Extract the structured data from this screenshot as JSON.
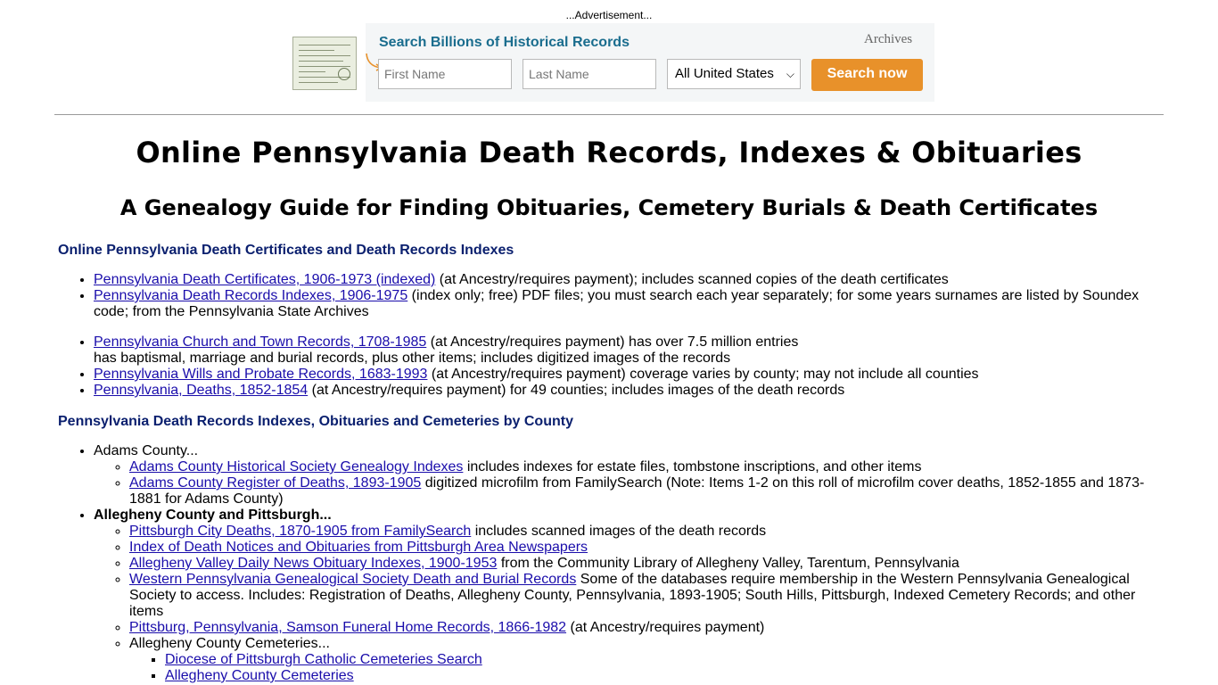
{
  "ad": {
    "label": "...Advertisement...",
    "title": "Search Billions of Historical Records",
    "brand": "Archives",
    "first_name_placeholder": "First Name",
    "last_name_placeholder": "Last Name",
    "location_selected": "All United States",
    "search_button": "Search now",
    "accent_color": "#e8912a",
    "title_color": "#1a6d8e"
  },
  "page": {
    "title": "Online Pennsylvania Death Records, Indexes & Obituaries",
    "subtitle": "A Genealogy Guide for Finding Obituaries, Cemetery Burials & Death Certificates",
    "link_color": "#1a0dab",
    "heading_color": "#0a1f6e"
  },
  "section1": {
    "heading": "Online Pennsylvania Death Certificates and Death Records Indexes",
    "items": [
      {
        "link": "Pennsylvania Death Certificates, 1906-1973 (indexed)",
        "text": " (at Ancestry/requires payment); includes scanned copies of the death certificates"
      },
      {
        "link": "Pennsylvania Death Records Indexes, 1906-1975",
        "text": " (index only; free) PDF files; you must search each year separately; for some years surnames are listed by Soundex code; from the Pennsylvania State Archives"
      },
      {
        "link": "Pennsylvania Church and Town Records, 1708-1985",
        "text": " (at Ancestry/requires payment) has over 7.5 million entries",
        "text2": "has baptismal, marriage and burial records, plus other items; includes digitized images of the records"
      },
      {
        "link": "Pennsylvania Wills and Probate Records, 1683-1993",
        "text": " (at Ancestry/requires payment) coverage varies by county; may not include all counties"
      },
      {
        "link": "Pennsylvania, Deaths, 1852-1854",
        "text": " (at Ancestry/requires payment) for 49 counties; includes images of the death records"
      }
    ]
  },
  "section2": {
    "heading": "Pennsylvania Death Records Indexes, Obituaries and Cemeteries by County",
    "adams": {
      "label": "Adams County...",
      "items": [
        {
          "link": "Adams County Historical Society Genealogy Indexes",
          "text": " includes indexes for estate files, tombstone inscriptions, and other items"
        },
        {
          "link": "Adams County Register of Deaths, 1893-1905",
          "text": " digitized microfilm from FamilySearch (Note: Items 1-2 on this roll of microfilm cover deaths, 1852-1855 and 1873-1881 for Adams County)"
        }
      ]
    },
    "allegheny": {
      "label": "Allegheny County and Pittsburgh...",
      "items": [
        {
          "link": "Pittsburgh City Deaths, 1870-1905 from FamilySearch",
          "text": " includes scanned images of the death records"
        },
        {
          "link": "Index of Death Notices and Obituaries from Pittsburgh Area Newspapers",
          "text": ""
        },
        {
          "link": "Allegheny Valley Daily News Obituary Indexes, 1900-1953",
          "text": " from the Community Library of Allegheny Valley, Tarentum, Pennsylvania"
        },
        {
          "link": "Western Pennsylvania Genealogical Society Death and Burial Records",
          "text": " Some of the databases require membership in the Western Pennsylvania Genealogical Society to access. Includes: Registration of Deaths, Allegheny County, Pennsylvania, 1893-1905; South Hills, Pittsburgh, Indexed Cemetery Records; and other items"
        },
        {
          "link": "Pittsburg, Pennsylvania, Samson Funeral Home Records, 1866-1982",
          "text": " (at Ancestry/requires payment)"
        }
      ],
      "cemeteries_label": "Allegheny County Cemeteries...",
      "cemeteries": [
        {
          "link": "Diocese of Pittsburgh Catholic Cemeteries Search"
        },
        {
          "link": "Allegheny County Cemeteries"
        }
      ]
    }
  }
}
